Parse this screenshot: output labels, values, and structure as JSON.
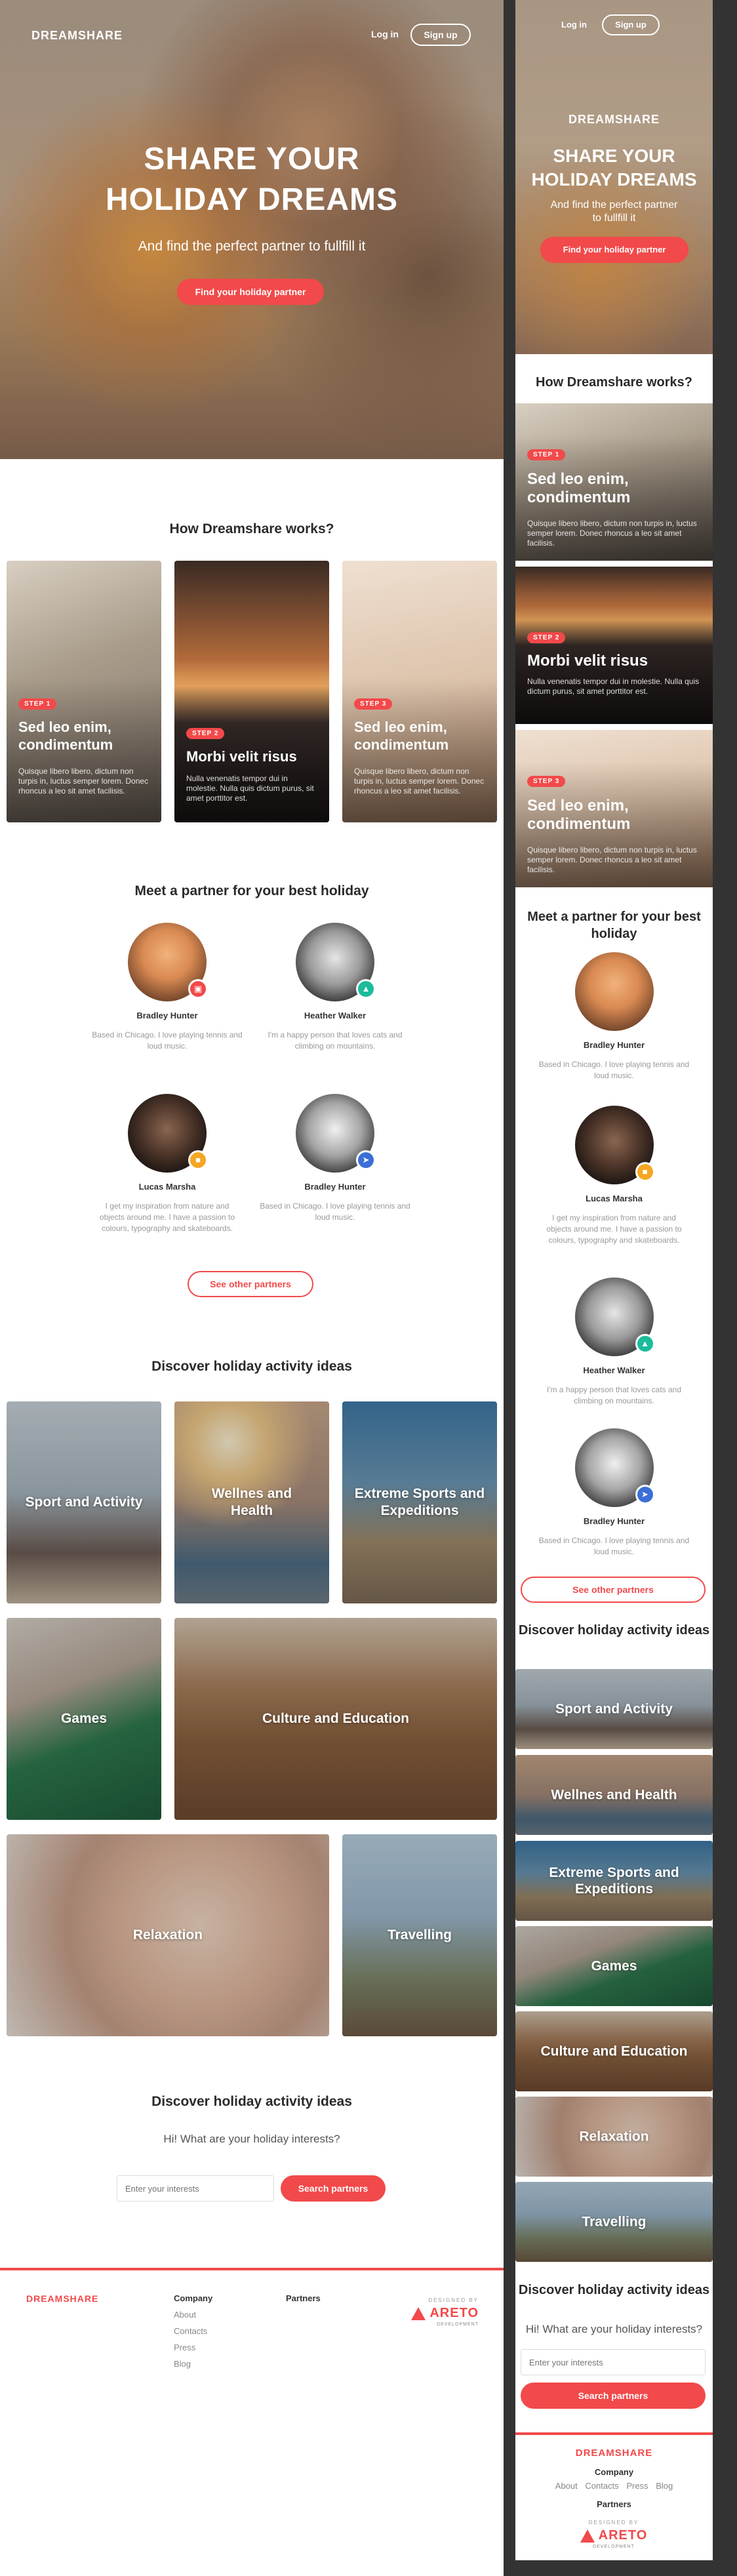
{
  "brand": {
    "name": "DREAMSHARE",
    "accent": "#f2494a"
  },
  "nav": {
    "login": "Log in",
    "signup": "Sign up"
  },
  "hero": {
    "title_line1": "SHARE YOUR",
    "title_line2": "HOLIDAY DREAMS",
    "subtitle": "And find the perfect partner to fullfill it",
    "subtitle_line1": "And find the perfect partner",
    "subtitle_line2": "to fullfill it",
    "cta": "Find your holiday partner"
  },
  "how": {
    "title": "How Dreamshare works?",
    "steps": [
      {
        "label": "STEP 1",
        "title": "Sed leo enim, condimentum",
        "desc": "Quisque libero libero, dictum non turpis in, luctus semper lorem. Donec rhoncus a leo sit amet facilisis."
      },
      {
        "label": "STEP 2",
        "title": "Morbi velit risus",
        "desc": "Nulla venenatis tempor dui in molestie. Nulla quis dictum purus, sit amet porttitor est."
      },
      {
        "label": "STEP 3",
        "title": "Sed leo enim, condimentum",
        "desc": "Quisque libero libero, dictum non turpis in, luctus semper lorem. Donec rhoncus a leo sit amet facilisis."
      }
    ]
  },
  "partners": {
    "title": "Meet a partner for your best holiday",
    "people": [
      {
        "name": "Bradley Hunter",
        "desc": "Based in Chicago. I love playing tennis and loud music.",
        "badge_color": "#f2494a",
        "badge_icon": "camera-icon"
      },
      {
        "name": "Heather Walker",
        "desc": "I'm a happy person that loves cats and climbing on mountains.",
        "badge_color": "#1bbc9b",
        "badge_icon": "mountain-icon"
      },
      {
        "name": "Lucas Marsha",
        "desc": "I get my inspiration from nature and objects around me. I have a passion to colours, typography and skateboards.",
        "badge_color": "#f5a623",
        "badge_icon": "lock-icon"
      },
      {
        "name": "Bradley Hunter",
        "desc": "Based in Chicago. I love playing tennis and loud music.",
        "badge_color": "#3b6fd8",
        "badge_icon": "plane-icon"
      }
    ],
    "see_more": "See other partners"
  },
  "activities": {
    "title": "Discover holiday activity ideas",
    "items": [
      {
        "title": "Sport and Activity"
      },
      {
        "title": "Wellnes and Health"
      },
      {
        "title": "Extreme Sports and Expeditions"
      },
      {
        "title": "Games"
      },
      {
        "title": "Culture and Education"
      },
      {
        "title": "Relaxation"
      },
      {
        "title": "Travelling"
      }
    ]
  },
  "interests": {
    "title": "Discover holiday activity ideas",
    "question": "Hi! What are your holiday interests?",
    "placeholder": "Enter your interests",
    "button": "Search partners"
  },
  "footer": {
    "company_title": "Company",
    "company_links": [
      "About",
      "Contacts",
      "Press",
      "Blog"
    ],
    "partners_title": "Partners",
    "designed_by": "DESIGNED BY",
    "areto": "ARETO",
    "development": "DEVELOPMENT"
  }
}
